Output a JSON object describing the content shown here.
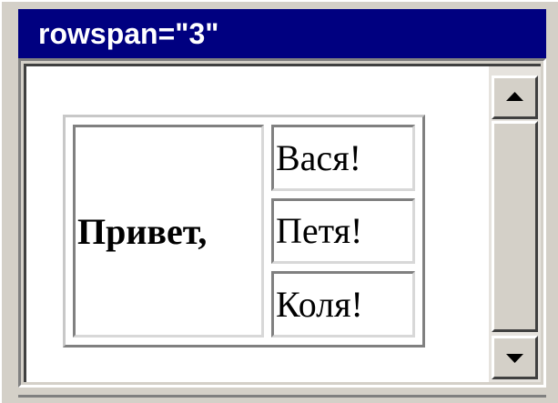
{
  "window": {
    "title": "rowspan=\"3\""
  },
  "table": {
    "span_cell": "Привет,",
    "rows": [
      "Вася!",
      "Петя!",
      "Коля!"
    ]
  },
  "scrollbar": {
    "up_icon": "triangle-up-icon",
    "down_icon": "triangle-down-icon"
  },
  "colors": {
    "titlebar": "#000080",
    "window_face": "#d4d0c8",
    "content_bg": "#ffffff"
  }
}
